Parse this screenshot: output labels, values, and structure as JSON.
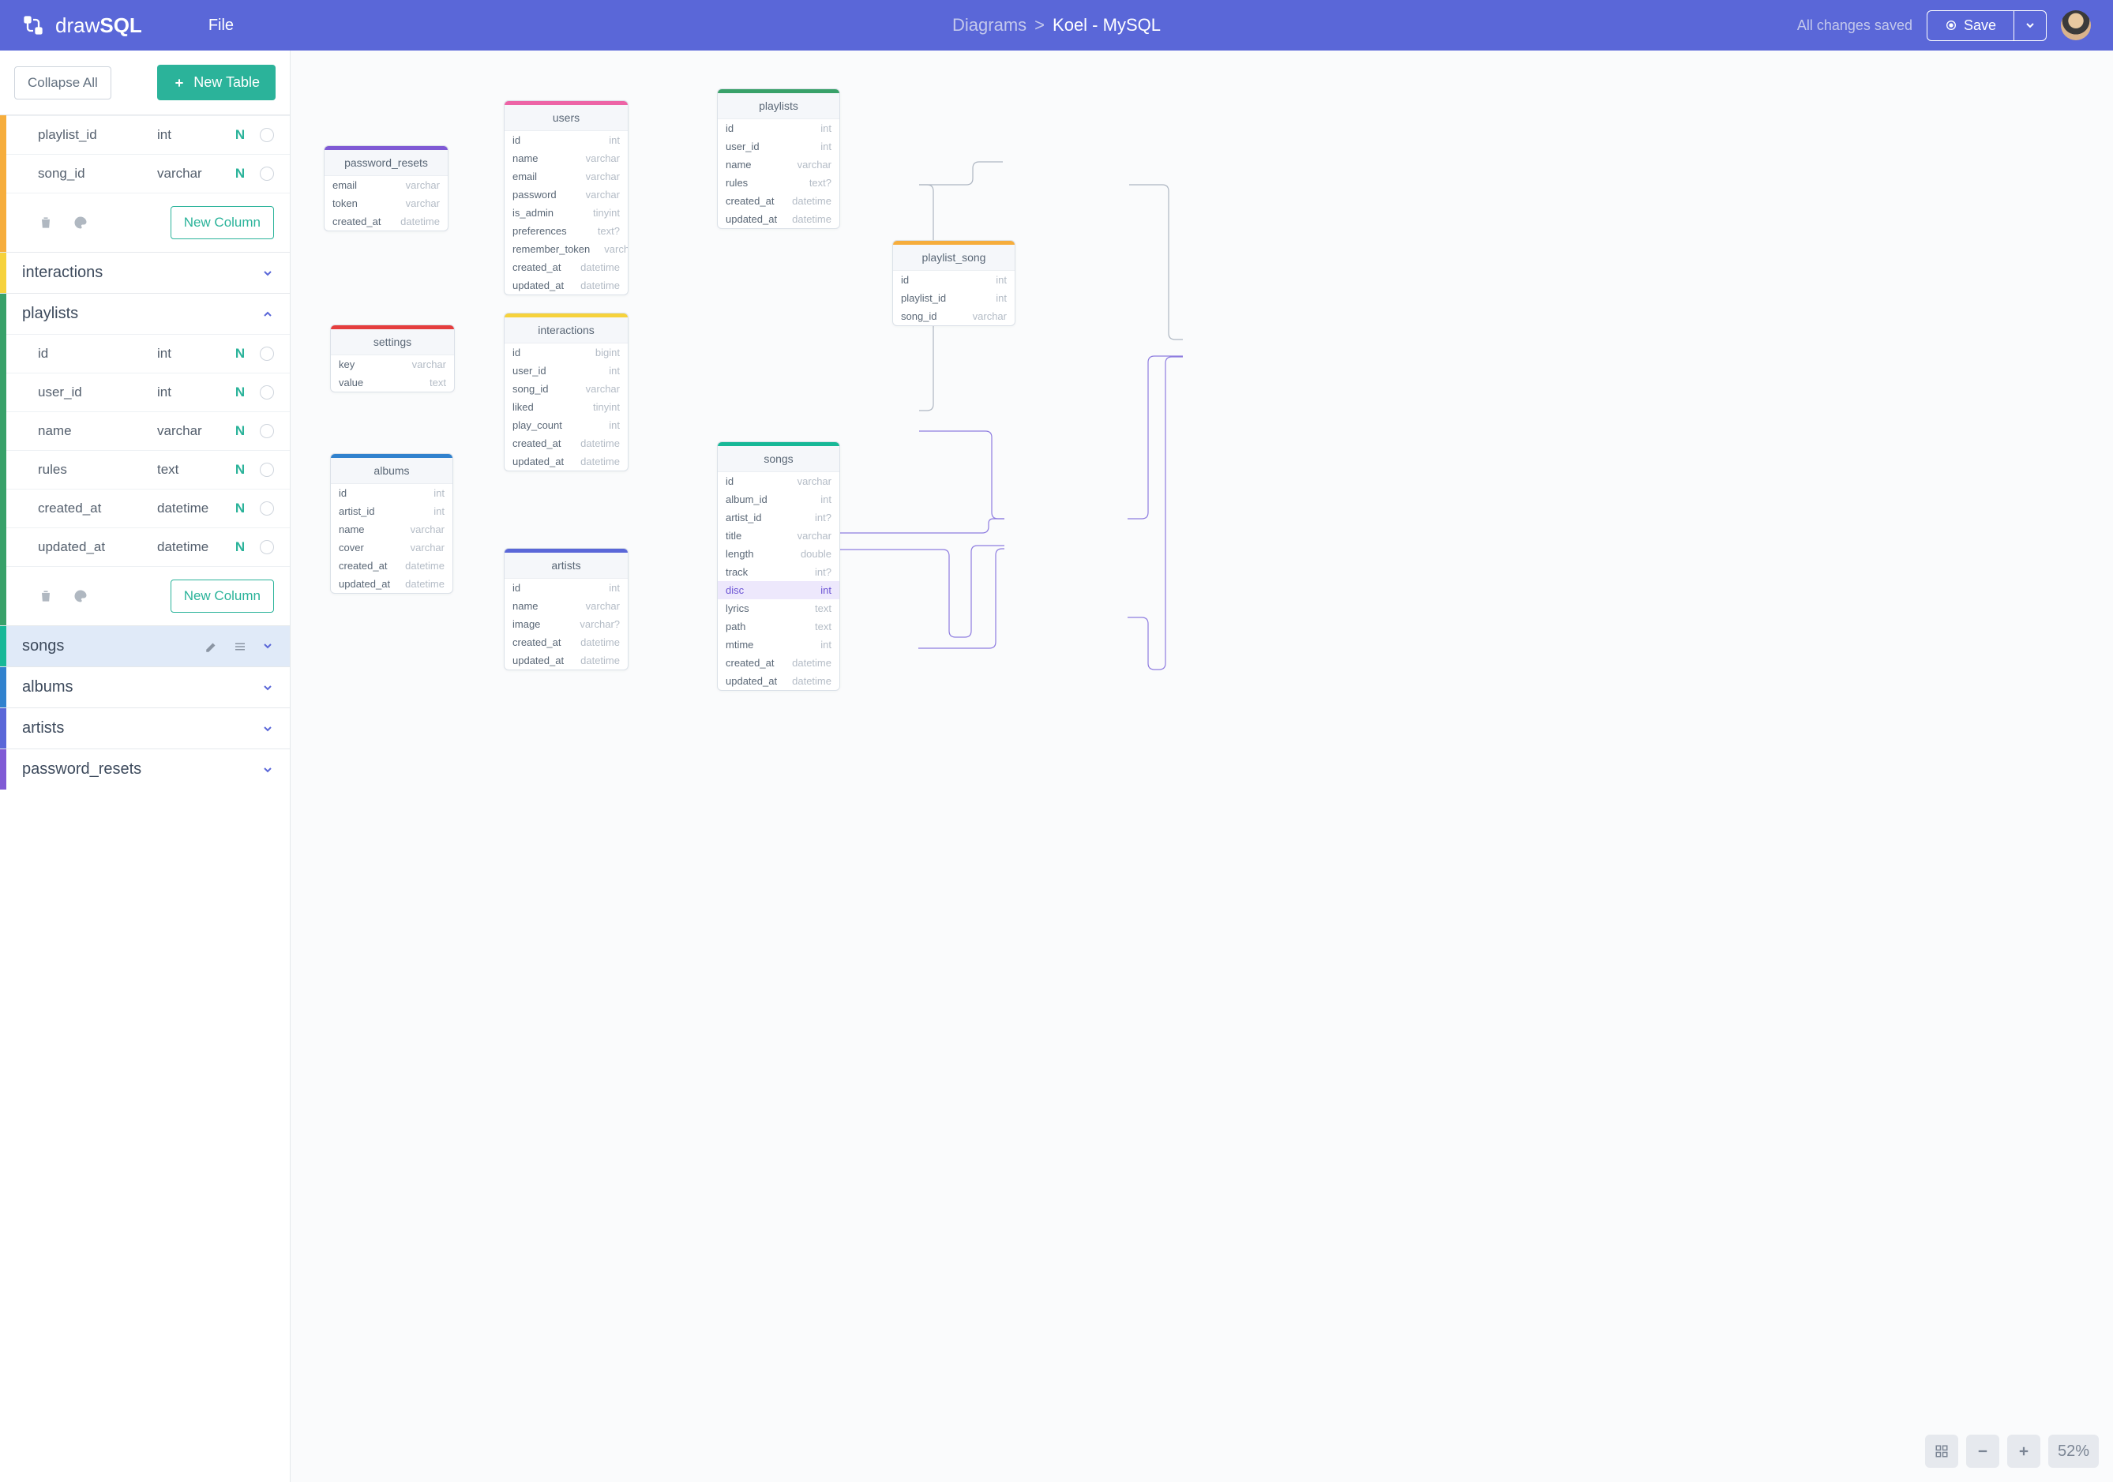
{
  "brand": {
    "draw": "draw",
    "sql": "SQL"
  },
  "menu": {
    "file": "File"
  },
  "breadcrumb": {
    "root": "Diagrams",
    "sep": ">",
    "current": "Koel - MySQL"
  },
  "status": {
    "autosave": "All changes saved"
  },
  "save": {
    "label": "Save"
  },
  "sidebar": {
    "collapse": "Collapse All",
    "new_table": "New Table",
    "new_column": "New Column",
    "section_top": {
      "columns": [
        {
          "name": "playlist_id",
          "type": "int",
          "n": "N"
        },
        {
          "name": "song_id",
          "type": "varchar",
          "n": "N"
        }
      ]
    },
    "interactions": {
      "label": "interactions"
    },
    "playlists": {
      "label": "playlists",
      "columns": [
        {
          "name": "id",
          "type": "int",
          "n": "N"
        },
        {
          "name": "user_id",
          "type": "int",
          "n": "N"
        },
        {
          "name": "name",
          "type": "varchar",
          "n": "N"
        },
        {
          "name": "rules",
          "type": "text",
          "n": "N"
        },
        {
          "name": "created_at",
          "type": "datetime",
          "n": "N"
        },
        {
          "name": "updated_at",
          "type": "datetime",
          "n": "N"
        }
      ]
    },
    "songs": {
      "label": "songs"
    },
    "albums": {
      "label": "albums"
    },
    "artists": {
      "label": "artists"
    },
    "password_resets": {
      "label": "password_resets"
    }
  },
  "canvas": {
    "password_resets": {
      "title": "password_resets",
      "cols": [
        [
          "email",
          "varchar"
        ],
        [
          "token",
          "varchar"
        ],
        [
          "created_at",
          "datetime"
        ]
      ]
    },
    "settings": {
      "title": "settings",
      "cols": [
        [
          "key",
          "varchar"
        ],
        [
          "value",
          "text"
        ]
      ]
    },
    "albums": {
      "title": "albums",
      "cols": [
        [
          "id",
          "int"
        ],
        [
          "artist_id",
          "int"
        ],
        [
          "name",
          "varchar"
        ],
        [
          "cover",
          "varchar"
        ],
        [
          "created_at",
          "datetime"
        ],
        [
          "updated_at",
          "datetime"
        ]
      ]
    },
    "users": {
      "title": "users",
      "cols": [
        [
          "id",
          "int"
        ],
        [
          "name",
          "varchar"
        ],
        [
          "email",
          "varchar"
        ],
        [
          "password",
          "varchar"
        ],
        [
          "is_admin",
          "tinyint"
        ],
        [
          "preferences",
          "text?"
        ],
        [
          "remember_token",
          "varchar?"
        ],
        [
          "created_at",
          "datetime"
        ],
        [
          "updated_at",
          "datetime"
        ]
      ]
    },
    "interactions": {
      "title": "interactions",
      "cols": [
        [
          "id",
          "bigint"
        ],
        [
          "user_id",
          "int"
        ],
        [
          "song_id",
          "varchar"
        ],
        [
          "liked",
          "tinyint"
        ],
        [
          "play_count",
          "int"
        ],
        [
          "created_at",
          "datetime"
        ],
        [
          "updated_at",
          "datetime"
        ]
      ]
    },
    "artists": {
      "title": "artists",
      "cols": [
        [
          "id",
          "int"
        ],
        [
          "name",
          "varchar"
        ],
        [
          "image",
          "varchar?"
        ],
        [
          "created_at",
          "datetime"
        ],
        [
          "updated_at",
          "datetime"
        ]
      ]
    },
    "playlists": {
      "title": "playlists",
      "cols": [
        [
          "id",
          "int"
        ],
        [
          "user_id",
          "int"
        ],
        [
          "name",
          "varchar"
        ],
        [
          "rules",
          "text?"
        ],
        [
          "created_at",
          "datetime"
        ],
        [
          "updated_at",
          "datetime"
        ]
      ]
    },
    "songs": {
      "title": "songs",
      "cols": [
        [
          "id",
          "varchar"
        ],
        [
          "album_id",
          "int"
        ],
        [
          "artist_id",
          "int?"
        ],
        [
          "title",
          "varchar"
        ],
        [
          "length",
          "double"
        ],
        [
          "track",
          "int?"
        ],
        [
          "disc",
          "int"
        ],
        [
          "lyrics",
          "text"
        ],
        [
          "path",
          "text"
        ],
        [
          "mtime",
          "int"
        ],
        [
          "created_at",
          "datetime"
        ],
        [
          "updated_at",
          "datetime"
        ]
      ]
    },
    "playlist_song": {
      "title": "playlist_song",
      "cols": [
        [
          "id",
          "int"
        ],
        [
          "playlist_id",
          "int"
        ],
        [
          "song_id",
          "varchar"
        ]
      ]
    }
  },
  "zoom": {
    "level": "52%"
  },
  "colors": {
    "orange": "#F6AD3C",
    "yellow": "#F6D23C",
    "green": "#2BB39A",
    "teal": "#17B897",
    "blue": "#3182CE",
    "indigo": "#5A67D8",
    "purple": "#805AD5",
    "red": "#E53E3E",
    "pink": "#ED64A6",
    "emerald": "#38A169"
  }
}
